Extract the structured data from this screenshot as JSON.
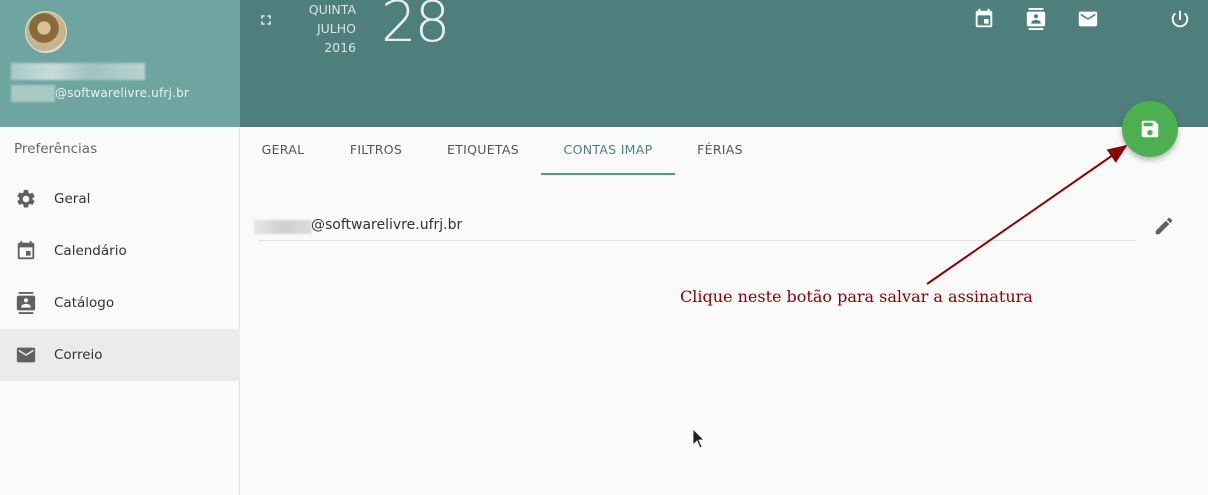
{
  "sidebar": {
    "user_email": "@softwarelivre.ufrj.br",
    "preferences_title": "Preferências",
    "items": [
      {
        "label": "Geral",
        "icon": "gear-icon"
      },
      {
        "label": "Calendário",
        "icon": "calendar-icon"
      },
      {
        "label": "Catálogo",
        "icon": "contacts-icon"
      },
      {
        "label": "Correio",
        "icon": "mail-icon"
      }
    ],
    "active_item": "Correio"
  },
  "header": {
    "weekday": "QUINTA",
    "month": "JULHO",
    "year": "2016",
    "day": "28",
    "icons": [
      "fullscreen-icon",
      "calendar-icon",
      "contacts-icon",
      "mail-icon",
      "power-icon"
    ]
  },
  "tabs": [
    {
      "label": "GERAL"
    },
    {
      "label": "FILTROS"
    },
    {
      "label": "ETIQUETAS"
    },
    {
      "label": "CONTAS IMAP"
    },
    {
      "label": "FÉRIAS"
    }
  ],
  "active_tab": "CONTAS IMAP",
  "account": {
    "email": "@softwarelivre.ufrj.br"
  },
  "annotation": {
    "text": "Clique neste botão para salvar a assinatura"
  },
  "colors": {
    "header_dark": "#4f7f7c",
    "header_light": "#6fa5a0",
    "fab": "#4caf50",
    "annotation": "#8b0000"
  }
}
